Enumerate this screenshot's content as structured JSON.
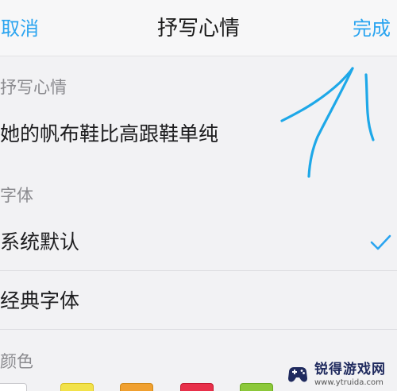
{
  "navbar": {
    "cancel_label": "取消",
    "title": "抒写心情",
    "done_label": "完成"
  },
  "mood_section": {
    "header": "抒写心情",
    "text_value": "她的帆布鞋比高跟鞋单纯"
  },
  "font_section": {
    "header": "字体",
    "options": [
      {
        "label": "系统默认",
        "selected": true
      },
      {
        "label": "经典字体",
        "selected": false
      }
    ]
  },
  "color_section": {
    "header": "颜色",
    "swatches": [
      "#ffffff",
      "#f2e24a",
      "#f0a030",
      "#e8304a",
      "#8cc83a"
    ]
  },
  "colors": {
    "accent": "#2aa4f0",
    "annotation": "#1ea8e8"
  },
  "watermark": {
    "title": "锐得游戏网",
    "url": "www.ytruida.com"
  }
}
